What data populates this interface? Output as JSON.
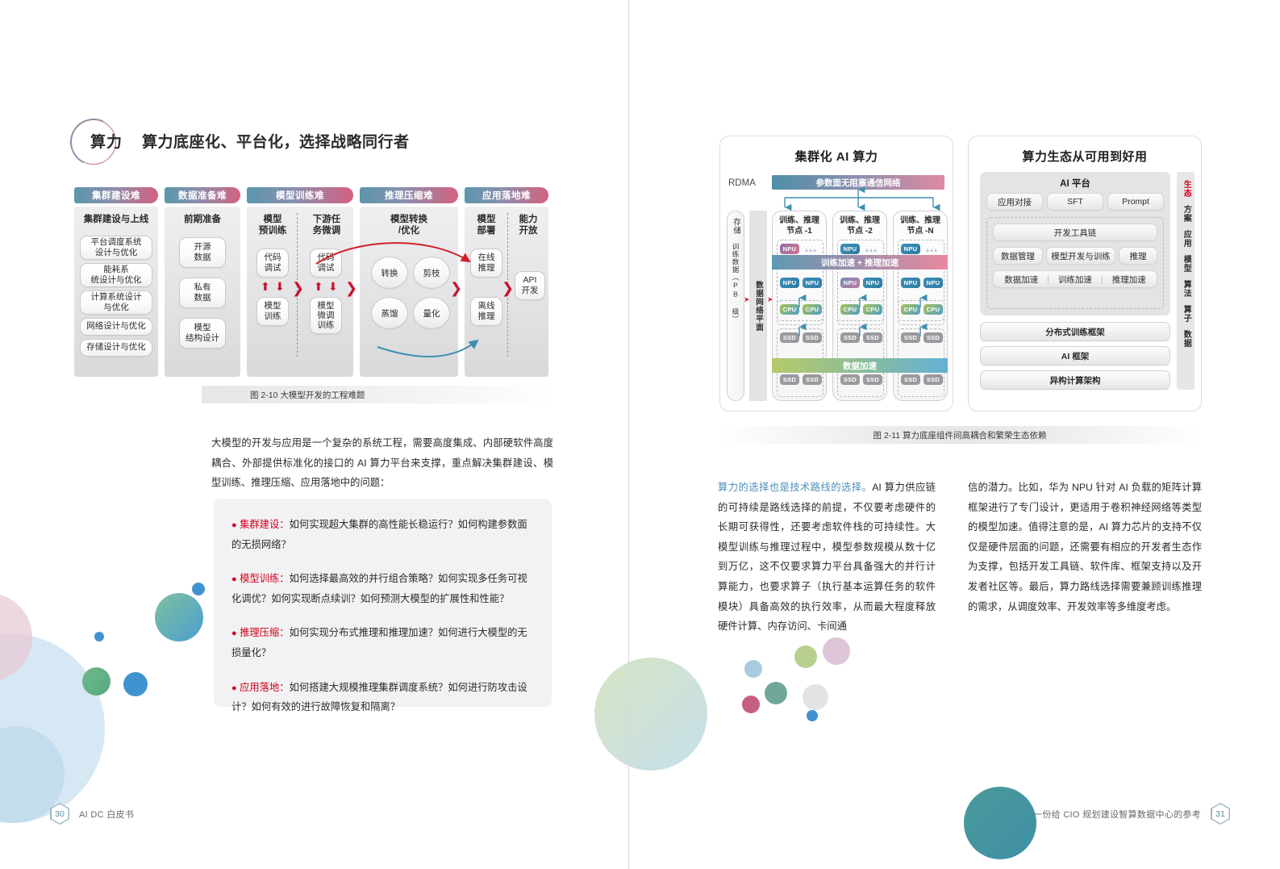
{
  "left_page": {
    "chapter": {
      "tag": "算力",
      "title": "算力底座化、平台化，选择战略同行者"
    },
    "figure_2_10": {
      "caption": "图 2-10 大模型开发的工程难题",
      "columns": [
        {
          "header": "集群建设难",
          "groups": [
            {
              "title": "集群建设与上线",
              "items": [
                "平台调度系统\n设计与优化",
                "能耗系\n统设计与优化",
                "计算系统设计\n与优化",
                "网络设计与优化",
                "存储设计与优化"
              ]
            }
          ]
        },
        {
          "header": "数据准备难",
          "groups": [
            {
              "title": "前期准备",
              "items": [
                "开源\n数据",
                "私有\n数据",
                "模型\n结构设计"
              ]
            }
          ]
        },
        {
          "header": "模型训练难",
          "groups": [
            {
              "title": "模型\n预训练",
              "items": [
                "代码\n调试",
                "模型\n训练"
              ]
            },
            {
              "title": "下游任\n务微调",
              "items": [
                "代码\n调试",
                "模型\n微调\n训练"
              ]
            }
          ]
        },
        {
          "header": "推理压缩难",
          "groups": [
            {
              "title": "模型转换\n/优化",
              "items": [
                "转换",
                "剪枝",
                "蒸馏",
                "量化"
              ]
            }
          ]
        },
        {
          "header": "应用落地难",
          "groups": [
            {
              "title": "模型\n部署",
              "items": [
                "在线\n推理",
                "离线\n推理"
              ]
            },
            {
              "title": "能力\n开放",
              "items": [
                "API\n开发"
              ]
            }
          ]
        }
      ]
    },
    "paragraph": "大模型的开发与应用是一个复杂的系统工程，需要高度集成、内部硬软件高度耦合、外部提供标准化的接口的 AI 算力平台来支撑，重点解决集群建设、模型训练、推理压缩、应用落地中的问题：",
    "qa_items": [
      {
        "key": "集群建设",
        "sep": "：",
        "text": "如何实现超大集群的高性能长稳运行？如何构建参数面的无损网络？"
      },
      {
        "key": "模型训练",
        "sep": "：",
        "text": "如何选择最高效的并行组合策略？如何实现多任务可视化调优？如何实现断点续训？如何预测大模型的扩展性和性能？"
      },
      {
        "key": "推理压缩",
        "sep": "：",
        "text": "如何实现分布式推理和推理加速？如何进行大模型的无损量化？"
      },
      {
        "key": "应用落地",
        "sep": "：",
        "text": "如何搭建大规模推理集群调度系统？如何进行防攻击设计？如何有效的进行故障恢复和隔离？"
      }
    ],
    "footer": {
      "page_number": "30",
      "text": "AI DC 白皮书"
    }
  },
  "right_page": {
    "figure_2_11": {
      "caption": "图 2-11 算力底座组件间高耦合和繁荣生态依赖",
      "panel_left": {
        "title": "集群化 AI 算力",
        "rdma_label": "RDMA",
        "network_bar": "参数面无阻塞通信网络",
        "storage_labels": [
          "存储",
          "训练数据（PB 级）"
        ],
        "data_plane_label": "数据网络平面",
        "train_accel_bar": "训练加速 + 推理加速",
        "data_accel_bar": "数据加速",
        "nodes": [
          {
            "title": "训练、推理\n节点 -1",
            "npu_row1": [
              "NPU"
            ],
            "npu_row2": [
              "NPU",
              "NPU"
            ],
            "cpu_row": [
              "CPU",
              "CPU"
            ],
            "ssd_row1": [
              "SSD",
              "SSD"
            ],
            "ssd_row2": [
              "SSD",
              "SSD"
            ]
          },
          {
            "title": "训练、推理\n节点 -2",
            "npu_row1": [
              "NPU"
            ],
            "npu_row2": [
              "NPU",
              "NPU"
            ],
            "cpu_row": [
              "CPU",
              "CPU"
            ],
            "ssd_row1": [
              "SSD",
              "SSD"
            ],
            "ssd_row2": [
              "SSD",
              "SSD"
            ]
          },
          {
            "title": "训练、推理\n节点 -N",
            "npu_row1": [
              "NPU"
            ],
            "npu_row2": [
              "NPU",
              "NPU"
            ],
            "cpu_row": [
              "CPU",
              "CPU"
            ],
            "ssd_row1": [
              "SSD",
              "SSD"
            ],
            "ssd_row2": [
              "SSD",
              "SSD"
            ]
          }
        ]
      },
      "panel_right": {
        "title": "算力生态从可用到好用",
        "platform_title": "AI 平台",
        "platform_row": [
          "应用对接",
          "SFT",
          "Prompt"
        ],
        "toolchain": "开发工具链",
        "toolchain_row": [
          "数据管理",
          "模型开发与训练",
          "推理"
        ],
        "accel_row": [
          "数据加速",
          "训练加速",
          "推理加速"
        ],
        "stack": [
          "分布式训练框架",
          "AI 框架",
          "异构计算架构"
        ],
        "eco_items": [
          "生态",
          "方案",
          "应用",
          "模型",
          "算法",
          "算子",
          "数据"
        ]
      }
    },
    "body_left_col": "算力的选择也是技术路线的选择。AI 算力供应链的可持续是路线选择的前提，不仅要考虑硬件的长期可获得性，还要考虑软件栈的可持续性。大模型训练与推理过程中，模型参数规模从数十亿到万亿，这不仅要求算力平台具备强大的并行计算能力，也要求算子（执行基本运算任务的软件模块）具备高效的执行效率，从而最大程度释放硬件计算、内存访问、卡间通",
    "body_left_highlight": "算力的选择也是技术路线的选择。",
    "body_right_col": "信的潜力。比如，华为 NPU 针对 AI 负载的矩阵计算框架进行了专门设计，更适用于卷积神经网络等类型的模型加速。值得注意的是，AI 算力芯片的支持不仅仅是硬件层面的问题，还需要有相应的开发者生态作为支撑，包括开发工具链、软件库、框架支持以及开发者社区等。最后，算力路线选择需要兼顾训练推理的需求，从调度效率、开发效率等多维度考虑。",
    "footer": {
      "text": "一份给 CIO 规划建设智算数据中心的参考",
      "page_number": "31"
    }
  },
  "colors": {
    "accent_red": "#d0021b",
    "teal": "#4e8fa8",
    "pink": "#d4617f",
    "highlight_blue": "#4a90b8"
  }
}
